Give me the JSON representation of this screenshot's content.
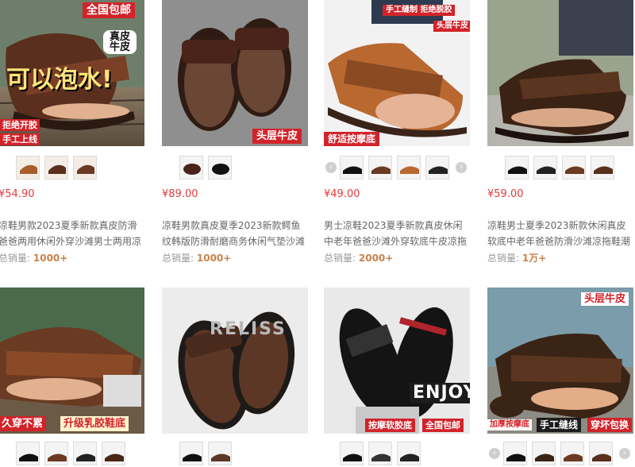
{
  "products": [
    {
      "price": "¥54.90",
      "title_lines": [
        "凉鞋男款2023夏季新款真皮防滑",
        "爸爸两用休闲外穿沙滩男士两用凉"
      ],
      "sales_label": "总销量:",
      "sales_value": "1000+",
      "badges": [
        "全国包邮",
        "真皮",
        "牛皮",
        "可以泡水!",
        "拒绝开胶",
        "手工上线"
      ]
    },
    {
      "price": "¥89.00",
      "title_lines": [
        "凉鞋男款真皮夏季2023新款鳄鱼",
        "纹韩版防滑耐磨商务休闲气垫沙滩"
      ],
      "sales_label": "总销量:",
      "sales_value": "1000+",
      "badges": [
        "头层牛皮"
      ]
    },
    {
      "price": "¥49.00",
      "title_lines": [
        "男士凉鞋2023夏季新款真皮休闲",
        "中老年爸爸沙滩外穿软底牛皮凉拖"
      ],
      "sales_label": "总销量:",
      "sales_value": "2000+",
      "badges": [
        "手工缝制 拒绝脱胶",
        "头层牛皮",
        "舒适按摩底"
      ]
    },
    {
      "price": "¥59.00",
      "title_lines": [
        "凉鞋男士夏季2023新款休闲真皮",
        "软底中老年爸爸防滑沙滩凉拖鞋潮"
      ],
      "sales_label": "总销量:",
      "sales_value": "1万+",
      "badges": []
    },
    {
      "badges": [
        "久穿不累",
        "升级乳胶鞋底"
      ]
    },
    {
      "badges": [
        "RELISS"
      ]
    },
    {
      "badges": [
        "按摩软胶底",
        "全国包邮",
        "ENJOY"
      ]
    },
    {
      "badges": [
        "头层牛皮",
        "加厚按摩底",
        "手工缝线",
        "穿坏包换"
      ]
    }
  ],
  "icons": {
    "prev": "‹",
    "next": "›"
  },
  "colors": {
    "price": "#e4393c",
    "sales_value": "#c9814b",
    "badge_red": "#d2232a",
    "leather": "#6b3a22"
  }
}
